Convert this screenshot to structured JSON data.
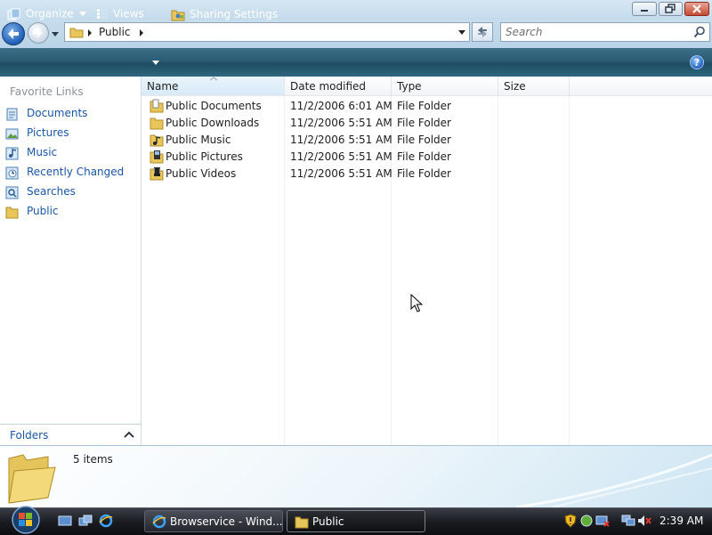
{
  "window": {
    "address": {
      "crumb": "Public"
    },
    "search": {
      "placeholder": "Search"
    }
  },
  "toolbar": {
    "organize_label": "Organize",
    "views_label": "Views",
    "sharing_label": "Sharing Settings",
    "help_label": "?"
  },
  "nav_pane": {
    "favorites_title": "Favorite Links",
    "links": [
      {
        "label": "Documents",
        "icon": "documents-icon"
      },
      {
        "label": "Pictures",
        "icon": "pictures-icon"
      },
      {
        "label": "Music",
        "icon": "music-icon"
      },
      {
        "label": "Recently Changed",
        "icon": "recently-changed-icon"
      },
      {
        "label": "Searches",
        "icon": "searches-icon"
      },
      {
        "label": "Public",
        "icon": "folder-icon"
      }
    ],
    "folders_label": "Folders"
  },
  "file_list": {
    "columns": [
      "Name",
      "Date modified",
      "Type",
      "Size"
    ],
    "rows": [
      {
        "name": "Public Documents",
        "date": "11/2/2006 6:01 AM",
        "type": "File Folder",
        "icon": "documents-folder-icon"
      },
      {
        "name": "Public Downloads",
        "date": "11/2/2006 5:51 AM",
        "type": "File Folder",
        "icon": "folder-icon"
      },
      {
        "name": "Public Music",
        "date": "11/2/2006 5:51 AM",
        "type": "File Folder",
        "icon": "music-folder-icon"
      },
      {
        "name": "Public Pictures",
        "date": "11/2/2006 5:51 AM",
        "type": "File Folder",
        "icon": "pictures-folder-icon"
      },
      {
        "name": "Public Videos",
        "date": "11/2/2006 5:51 AM",
        "type": "File Folder",
        "icon": "videos-folder-icon"
      }
    ]
  },
  "details": {
    "item_count": "5 items"
  },
  "taskbar": {
    "tasks": [
      {
        "label": "Browservice - Wind...",
        "active": false,
        "icon": "ie-icon"
      },
      {
        "label": "Public",
        "active": true,
        "icon": "folder-icon"
      }
    ],
    "clock": "2:39 AM"
  },
  "colors": {
    "link": "#1a56a6",
    "command_bar": "#2b5c74",
    "taskbar": "#1b1d22"
  }
}
